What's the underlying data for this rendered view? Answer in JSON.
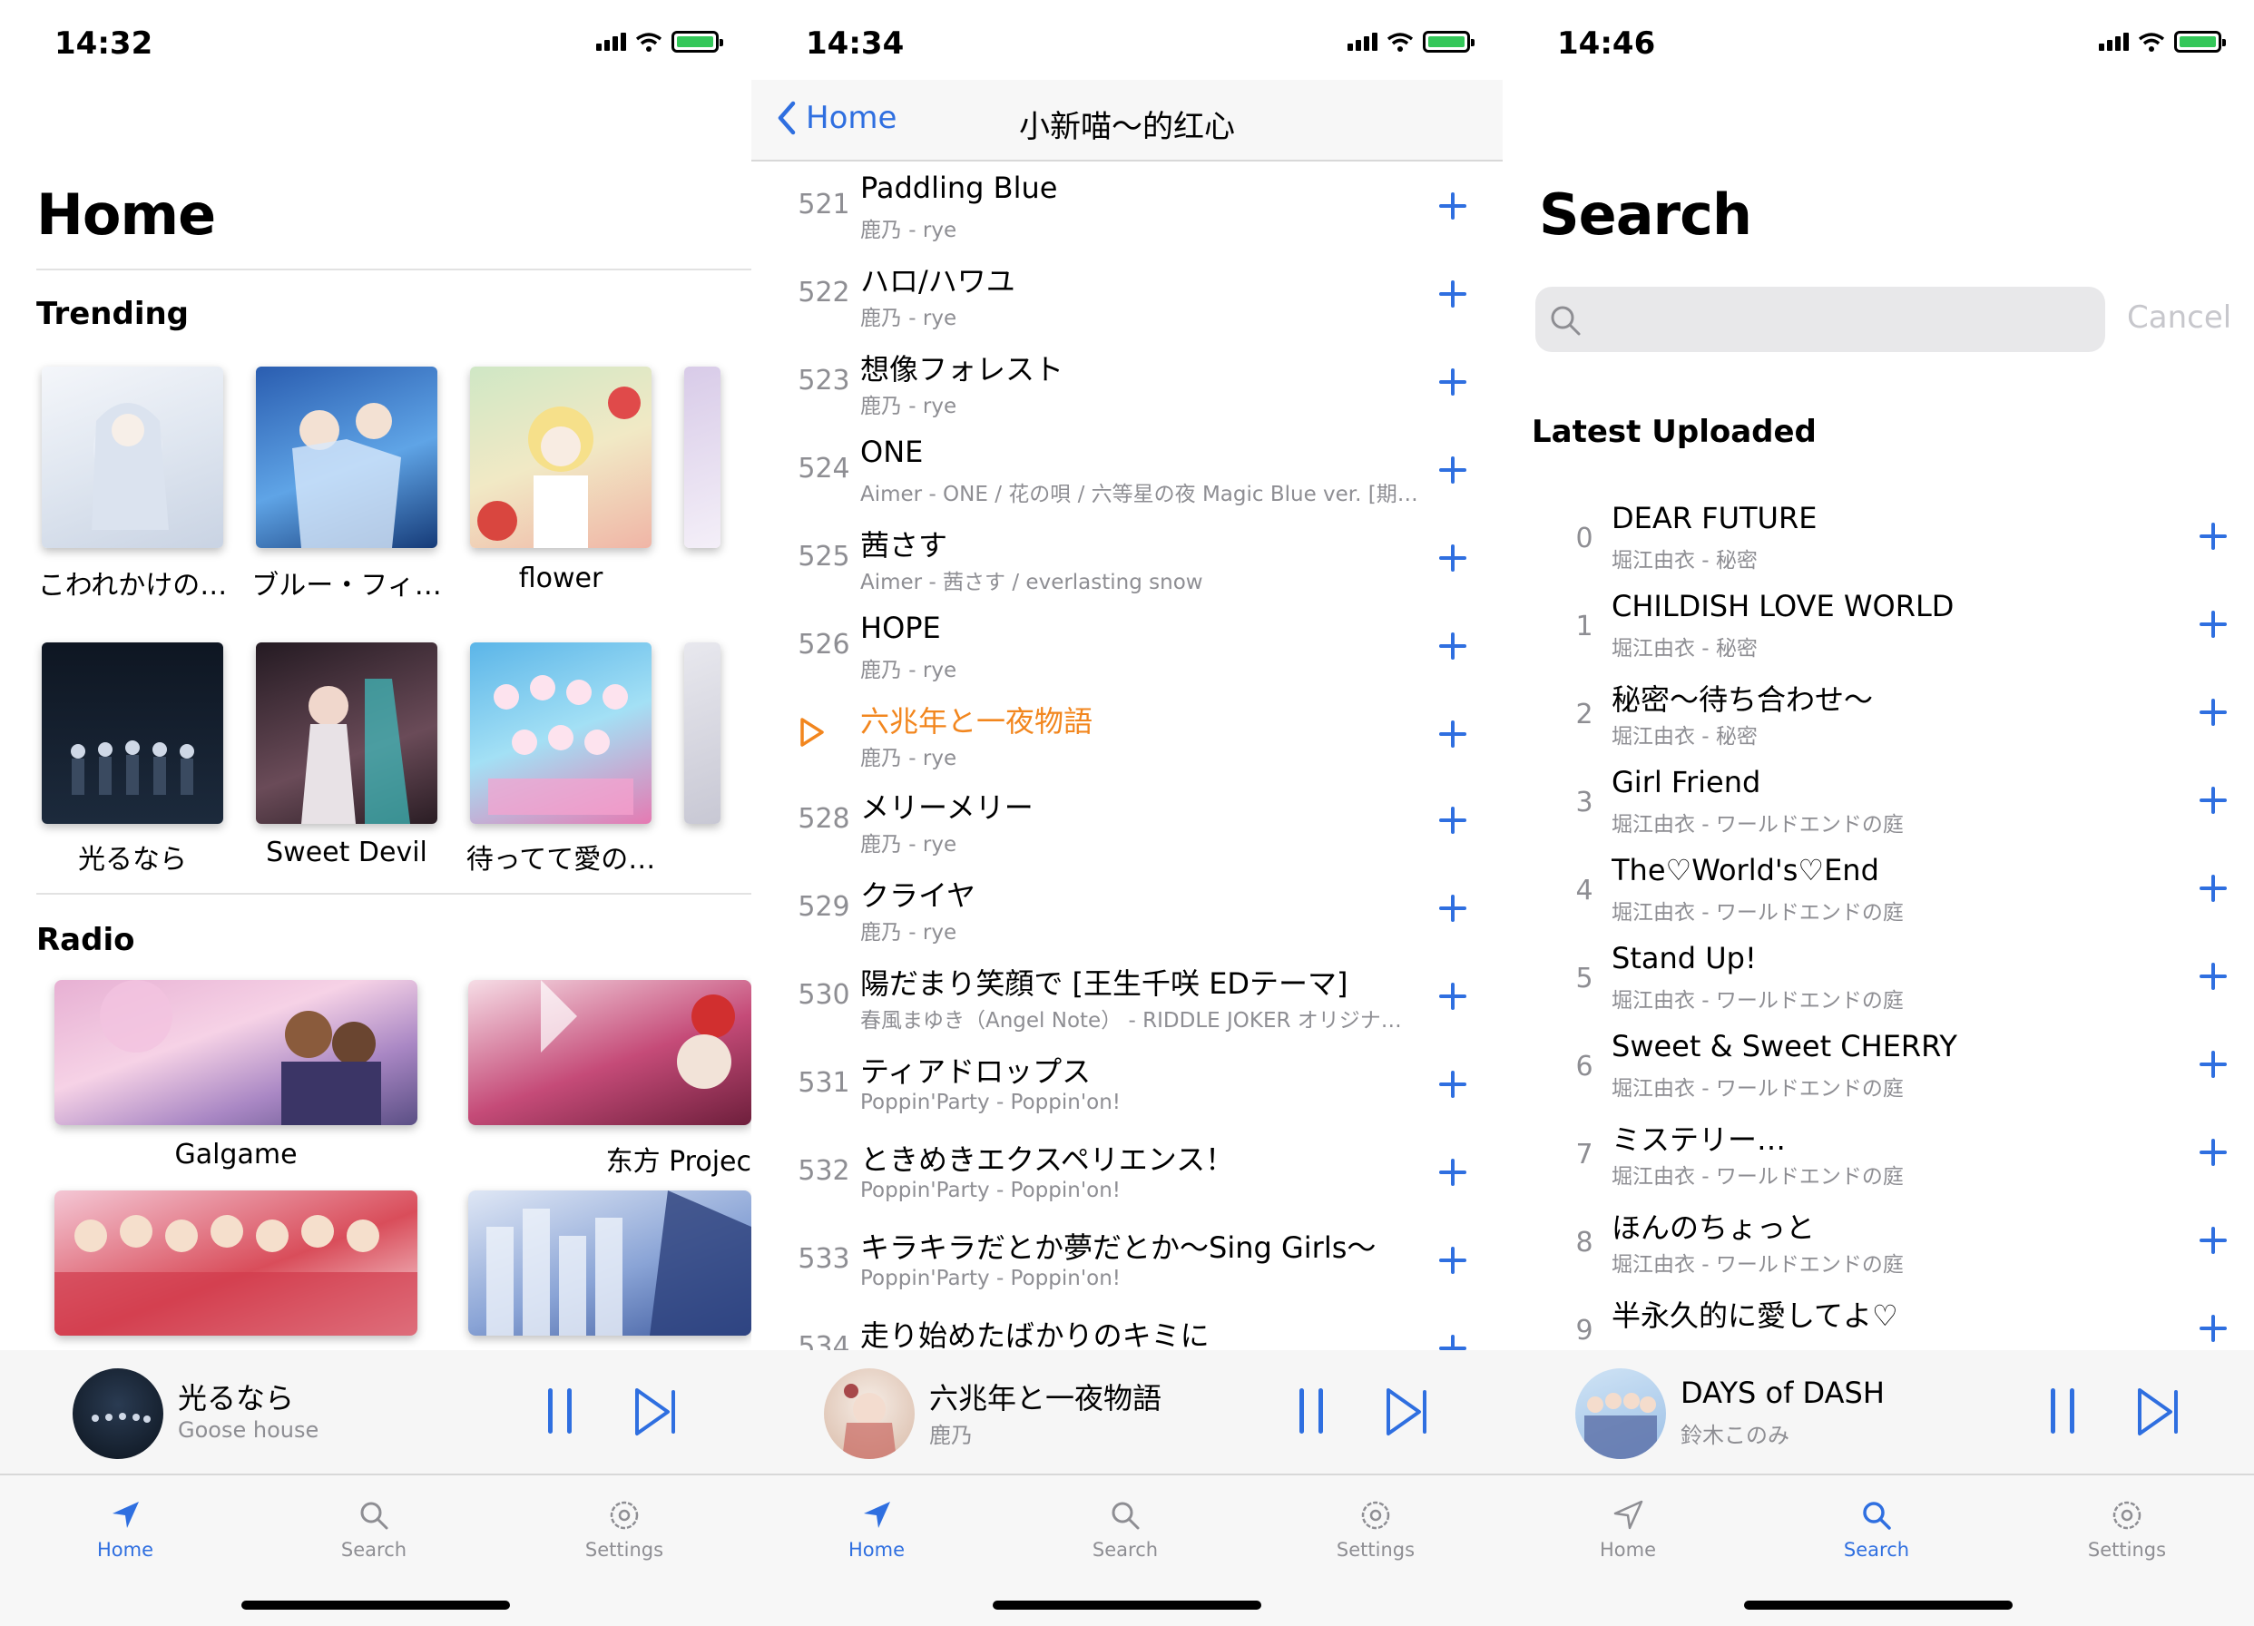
{
  "screens": [
    {
      "status_time": "14:32",
      "title": "Home",
      "trending_label": "Trending",
      "trending": [
        {
          "label": "こわれかけの…"
        },
        {
          "label": "ブルー・フィ…"
        },
        {
          "label": "flower"
        },
        {
          "label": "光るなら"
        },
        {
          "label": "Sweet Devil"
        },
        {
          "label": "待ってて愛の…"
        }
      ],
      "radio_label": "Radio",
      "radio": [
        {
          "label": "Galgame"
        },
        {
          "label": "东方 Projec"
        },
        {
          "label": ""
        },
        {
          "label": ""
        }
      ],
      "player": {
        "title": "光るなら",
        "artist": "Goose house"
      }
    },
    {
      "status_time": "14:34",
      "nav_back": "Home",
      "nav_title": "小新喵～的红心",
      "tracks": [
        {
          "num": "521",
          "title": "Paddling Blue",
          "sub": "鹿乃 - rye"
        },
        {
          "num": "522",
          "title": "ハロ/ハワユ",
          "sub": "鹿乃 - rye"
        },
        {
          "num": "523",
          "title": "想像フォレスト",
          "sub": "鹿乃 - rye"
        },
        {
          "num": "524",
          "title": "ONE",
          "sub": "Aimer - ONE / 花の唄 / 六等星の夜 Magic Blue ver. [期…"
        },
        {
          "num": "525",
          "title": "茜さす",
          "sub": "Aimer - 茜さす / everlasting snow"
        },
        {
          "num": "526",
          "title": "HOPE",
          "sub": "鹿乃 - rye"
        },
        {
          "num": "",
          "title": "六兆年と一夜物語",
          "sub": "鹿乃 - rye"
        },
        {
          "num": "528",
          "title": "メリーメリー",
          "sub": "鹿乃 - rye"
        },
        {
          "num": "529",
          "title": "クライヤ",
          "sub": "鹿乃 - rye"
        },
        {
          "num": "530",
          "title": "陽だまり笑顔で [王生千咲 EDテーマ]",
          "sub": "春風まゆき（Angel Note） - RIDDLE JOKER オリジナ…"
        },
        {
          "num": "531",
          "title": "ティアドロップス",
          "sub": "Poppin'Party - Poppin'on!"
        },
        {
          "num": "532",
          "title": "ときめきエクスペリエンス！",
          "sub": "Poppin'Party - Poppin'on!"
        },
        {
          "num": "533",
          "title": "キラキラだとか夢だとか～Sing Girls～",
          "sub": "Poppin'Party - Poppin'on!"
        },
        {
          "num": "534",
          "title": "走り始めたばかりのキミに",
          "sub": ""
        }
      ],
      "player": {
        "title": "六兆年と一夜物語",
        "artist": "鹿乃"
      }
    },
    {
      "status_time": "14:46",
      "title": "Search",
      "search_placeholder": "",
      "cancel_label": "Cancel",
      "section_label": "Latest Uploaded",
      "tracks": [
        {
          "num": "0",
          "title": "DEAR FUTURE",
          "sub": "堀江由衣 - 秘密"
        },
        {
          "num": "1",
          "title": "CHILDISH LOVE WORLD",
          "sub": "堀江由衣 - 秘密"
        },
        {
          "num": "2",
          "title": "秘密～待ち合わせ～",
          "sub": "堀江由衣 - 秘密"
        },
        {
          "num": "3",
          "title": "Girl Friend",
          "sub": "堀江由衣 - ワールドエンドの庭"
        },
        {
          "num": "4",
          "title": "The♡World's♡End",
          "sub": "堀江由衣 - ワールドエンドの庭"
        },
        {
          "num": "5",
          "title": "Stand Up!",
          "sub": "堀江由衣 - ワールドエンドの庭"
        },
        {
          "num": "6",
          "title": "Sweet & Sweet CHERRY",
          "sub": "堀江由衣 - ワールドエンドの庭"
        },
        {
          "num": "7",
          "title": "ミステリー…",
          "sub": "堀江由衣 - ワールドエンドの庭"
        },
        {
          "num": "8",
          "title": "ほんのちょっと",
          "sub": "堀江由衣 - ワールドエンドの庭"
        },
        {
          "num": "9",
          "title": "半永久的に愛してよ♡",
          "sub": ""
        }
      ],
      "player": {
        "title": "DAYS of DASH",
        "artist": "鈴木このみ"
      }
    }
  ],
  "tabs": {
    "home": "Home",
    "search": "Search",
    "settings": "Settings"
  },
  "colors": {
    "accent": "#2f6fe0",
    "playing": "#f2861e",
    "secondary": "#8e8e93"
  }
}
